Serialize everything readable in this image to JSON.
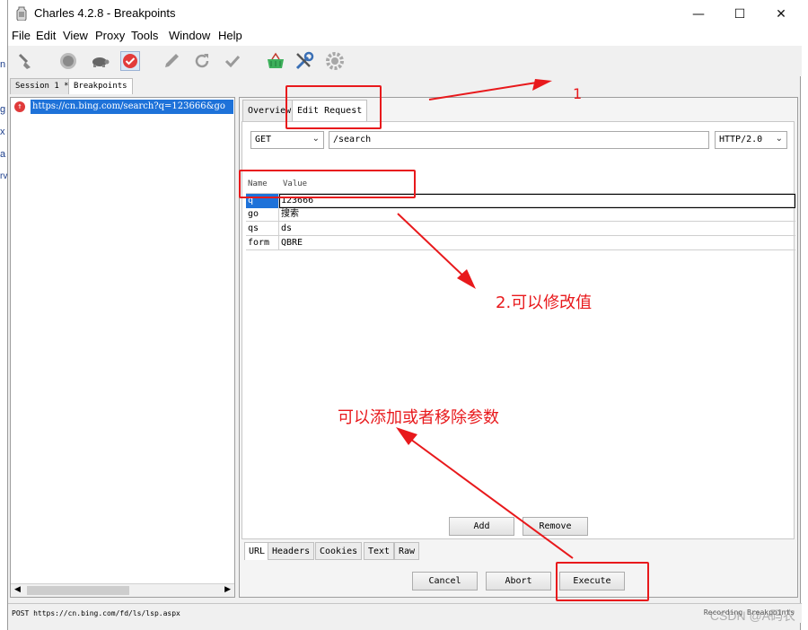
{
  "window": {
    "title": "Charles 4.2.8 - Breakpoints"
  },
  "menu": [
    "File",
    "Edit",
    "View",
    "Proxy",
    "Tools",
    "Window",
    "Help"
  ],
  "toolbar_icons": [
    "broom-icon",
    "record-icon",
    "turtle-icon",
    "breakpoint-icon",
    "pen-icon",
    "refresh-icon",
    "check-icon",
    "basket-icon",
    "tools-icon",
    "settings-icon"
  ],
  "session_tabs": [
    "Session 1 *",
    "Breakpoints"
  ],
  "left_edge_letters": [
    "n",
    "g",
    "x",
    "a",
    "rv"
  ],
  "tree": {
    "url": "https://cn.bing.com/search?q=123666&go"
  },
  "request_tabs": [
    "Overview",
    "Edit Request"
  ],
  "request": {
    "method": "GET",
    "path": "/search",
    "protocol": "HTTP/2.0"
  },
  "params": {
    "headers": [
      "Name",
      "Value"
    ],
    "rows": [
      {
        "name": "q",
        "value": "123666"
      },
      {
        "name": "go",
        "value": "搜索"
      },
      {
        "name": "qs",
        "value": "ds"
      },
      {
        "name": "form",
        "value": "QBRE"
      }
    ]
  },
  "param_buttons": {
    "add": "Add",
    "remove": "Remove"
  },
  "bottom_tabs": [
    "URL",
    "Headers",
    "Cookies",
    "Text",
    "Raw"
  ],
  "actions": {
    "cancel": "Cancel",
    "abort": "Abort",
    "execute": "Execute"
  },
  "status": {
    "text": "POST https://cn.bing.com/fd/ls/lsp.aspx",
    "right": "Recording  Breakpoints"
  },
  "annotations": {
    "step1": "1",
    "step2": "2.可以修改值",
    "step3": "可以添加或者移除参数",
    "color": "#e8191c"
  },
  "watermark": "CSDN @A码农"
}
